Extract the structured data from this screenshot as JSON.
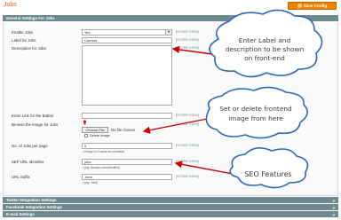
{
  "page": {
    "title": "Jobs"
  },
  "toolbar": {
    "save_label": "Save Config"
  },
  "sections": {
    "general": "General Settings For Jobs",
    "twitter": "Twitter Integration Settings",
    "facebook": "Facebook Integration Settings",
    "email": "E-mail Settings"
  },
  "fields": {
    "enable_jobs": {
      "label": "Enable Jobs",
      "value": "Yes",
      "scope": "[STORE VIEW]"
    },
    "label_for_jobs": {
      "label": "Label for Jobs",
      "value": "Careers",
      "scope": "[STORE VIEW]"
    },
    "description": {
      "label": "Description for Jobs",
      "scope": "[STORE VIEW]"
    },
    "enter_link": {
      "label": "Enter Link for the Button",
      "scope": "[STORE VIEW]"
    },
    "browse_image": {
      "label": "Browse the Image for Jobs",
      "button": "Choose File",
      "no_file": "No file chosen",
      "delete_label": "Delete Image",
      "scope": "[STORE VIEW]"
    },
    "jobs_per_page": {
      "label": "No. of Jobs per page",
      "value": "5",
      "hint": "• Empty or 0 value for unlimited",
      "scope": "[STORE VIEW]"
    },
    "sef_url": {
      "label": "SEF URL Identifier",
      "value": "jobs",
      "hint": "• (eg: domain.com/identifier)",
      "scope": "[STORE VIEW]"
    },
    "url_suffix": {
      "label": "URL Suffix",
      "value": ".html",
      "hint": "• (eg: .html)",
      "scope": "[STORE VIEW]"
    }
  },
  "callouts": {
    "label_desc": [
      "Enter Label and",
      "description to be shown",
      "on front-end"
    ],
    "image": [
      "Set or delete frontend",
      "image from here"
    ],
    "seo": [
      "SEO Features"
    ]
  },
  "colors": {
    "accent": "#eb5e00",
    "section_bg": "#6f8992",
    "callout_border": "#2e67b6",
    "arrow": "#cc0000"
  }
}
